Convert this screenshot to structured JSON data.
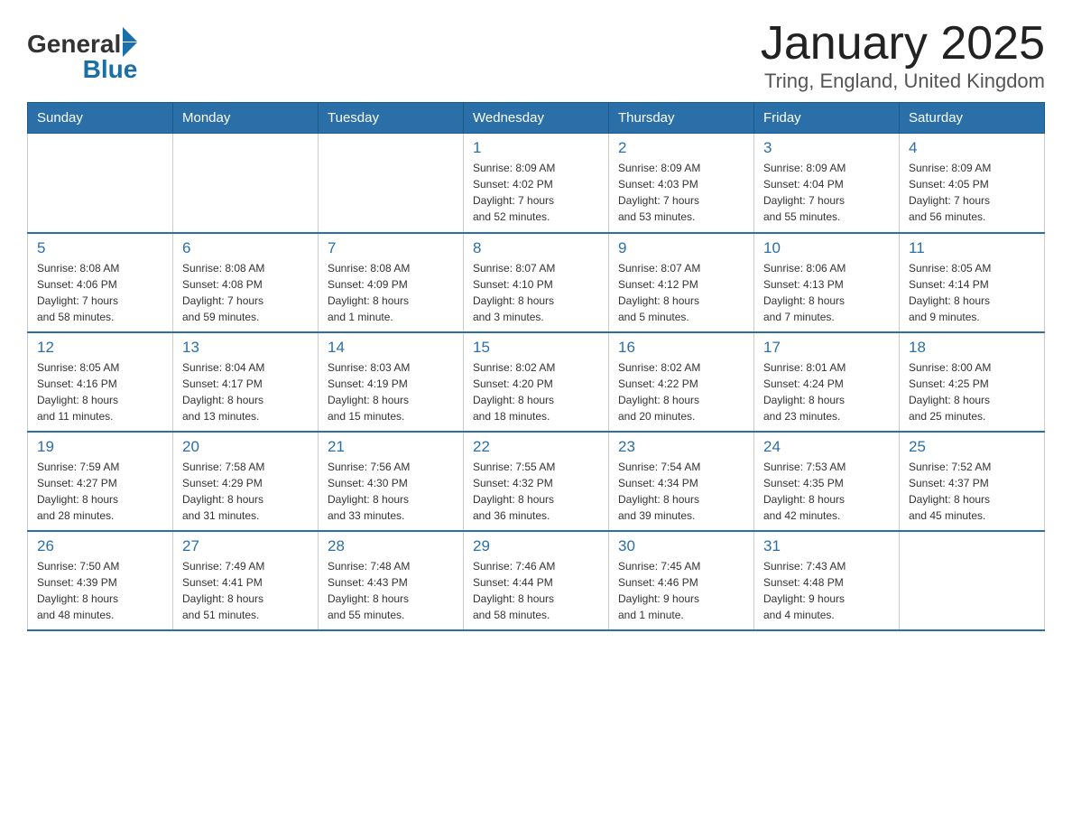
{
  "logo": {
    "text_general": "General",
    "text_blue": "Blue",
    "triangle": "▶"
  },
  "title": "January 2025",
  "subtitle": "Tring, England, United Kingdom",
  "headers": [
    "Sunday",
    "Monday",
    "Tuesday",
    "Wednesday",
    "Thursday",
    "Friday",
    "Saturday"
  ],
  "weeks": [
    [
      {
        "day": "",
        "info": ""
      },
      {
        "day": "",
        "info": ""
      },
      {
        "day": "",
        "info": ""
      },
      {
        "day": "1",
        "info": "Sunrise: 8:09 AM\nSunset: 4:02 PM\nDaylight: 7 hours\nand 52 minutes."
      },
      {
        "day": "2",
        "info": "Sunrise: 8:09 AM\nSunset: 4:03 PM\nDaylight: 7 hours\nand 53 minutes."
      },
      {
        "day": "3",
        "info": "Sunrise: 8:09 AM\nSunset: 4:04 PM\nDaylight: 7 hours\nand 55 minutes."
      },
      {
        "day": "4",
        "info": "Sunrise: 8:09 AM\nSunset: 4:05 PM\nDaylight: 7 hours\nand 56 minutes."
      }
    ],
    [
      {
        "day": "5",
        "info": "Sunrise: 8:08 AM\nSunset: 4:06 PM\nDaylight: 7 hours\nand 58 minutes."
      },
      {
        "day": "6",
        "info": "Sunrise: 8:08 AM\nSunset: 4:08 PM\nDaylight: 7 hours\nand 59 minutes."
      },
      {
        "day": "7",
        "info": "Sunrise: 8:08 AM\nSunset: 4:09 PM\nDaylight: 8 hours\nand 1 minute."
      },
      {
        "day": "8",
        "info": "Sunrise: 8:07 AM\nSunset: 4:10 PM\nDaylight: 8 hours\nand 3 minutes."
      },
      {
        "day": "9",
        "info": "Sunrise: 8:07 AM\nSunset: 4:12 PM\nDaylight: 8 hours\nand 5 minutes."
      },
      {
        "day": "10",
        "info": "Sunrise: 8:06 AM\nSunset: 4:13 PM\nDaylight: 8 hours\nand 7 minutes."
      },
      {
        "day": "11",
        "info": "Sunrise: 8:05 AM\nSunset: 4:14 PM\nDaylight: 8 hours\nand 9 minutes."
      }
    ],
    [
      {
        "day": "12",
        "info": "Sunrise: 8:05 AM\nSunset: 4:16 PM\nDaylight: 8 hours\nand 11 minutes."
      },
      {
        "day": "13",
        "info": "Sunrise: 8:04 AM\nSunset: 4:17 PM\nDaylight: 8 hours\nand 13 minutes."
      },
      {
        "day": "14",
        "info": "Sunrise: 8:03 AM\nSunset: 4:19 PM\nDaylight: 8 hours\nand 15 minutes."
      },
      {
        "day": "15",
        "info": "Sunrise: 8:02 AM\nSunset: 4:20 PM\nDaylight: 8 hours\nand 18 minutes."
      },
      {
        "day": "16",
        "info": "Sunrise: 8:02 AM\nSunset: 4:22 PM\nDaylight: 8 hours\nand 20 minutes."
      },
      {
        "day": "17",
        "info": "Sunrise: 8:01 AM\nSunset: 4:24 PM\nDaylight: 8 hours\nand 23 minutes."
      },
      {
        "day": "18",
        "info": "Sunrise: 8:00 AM\nSunset: 4:25 PM\nDaylight: 8 hours\nand 25 minutes."
      }
    ],
    [
      {
        "day": "19",
        "info": "Sunrise: 7:59 AM\nSunset: 4:27 PM\nDaylight: 8 hours\nand 28 minutes."
      },
      {
        "day": "20",
        "info": "Sunrise: 7:58 AM\nSunset: 4:29 PM\nDaylight: 8 hours\nand 31 minutes."
      },
      {
        "day": "21",
        "info": "Sunrise: 7:56 AM\nSunset: 4:30 PM\nDaylight: 8 hours\nand 33 minutes."
      },
      {
        "day": "22",
        "info": "Sunrise: 7:55 AM\nSunset: 4:32 PM\nDaylight: 8 hours\nand 36 minutes."
      },
      {
        "day": "23",
        "info": "Sunrise: 7:54 AM\nSunset: 4:34 PM\nDaylight: 8 hours\nand 39 minutes."
      },
      {
        "day": "24",
        "info": "Sunrise: 7:53 AM\nSunset: 4:35 PM\nDaylight: 8 hours\nand 42 minutes."
      },
      {
        "day": "25",
        "info": "Sunrise: 7:52 AM\nSunset: 4:37 PM\nDaylight: 8 hours\nand 45 minutes."
      }
    ],
    [
      {
        "day": "26",
        "info": "Sunrise: 7:50 AM\nSunset: 4:39 PM\nDaylight: 8 hours\nand 48 minutes."
      },
      {
        "day": "27",
        "info": "Sunrise: 7:49 AM\nSunset: 4:41 PM\nDaylight: 8 hours\nand 51 minutes."
      },
      {
        "day": "28",
        "info": "Sunrise: 7:48 AM\nSunset: 4:43 PM\nDaylight: 8 hours\nand 55 minutes."
      },
      {
        "day": "29",
        "info": "Sunrise: 7:46 AM\nSunset: 4:44 PM\nDaylight: 8 hours\nand 58 minutes."
      },
      {
        "day": "30",
        "info": "Sunrise: 7:45 AM\nSunset: 4:46 PM\nDaylight: 9 hours\nand 1 minute."
      },
      {
        "day": "31",
        "info": "Sunrise: 7:43 AM\nSunset: 4:48 PM\nDaylight: 9 hours\nand 4 minutes."
      },
      {
        "day": "",
        "info": ""
      }
    ]
  ]
}
